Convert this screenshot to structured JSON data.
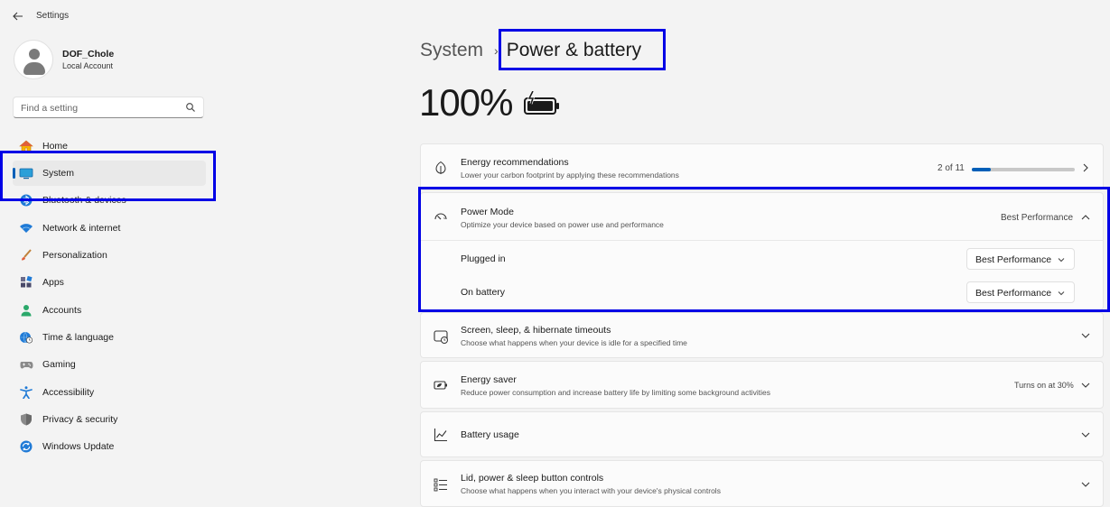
{
  "window": {
    "title": "Settings"
  },
  "profile": {
    "name": "DOF_Chole",
    "account": "Local Account"
  },
  "search": {
    "placeholder": "Find a setting"
  },
  "sidebar": {
    "items": [
      {
        "label": "Home",
        "icon": "home-icon"
      },
      {
        "label": "System",
        "icon": "system-icon",
        "selected": true
      },
      {
        "label": "Bluetooth & devices",
        "icon": "bluetooth-icon"
      },
      {
        "label": "Network & internet",
        "icon": "wifi-icon"
      },
      {
        "label": "Personalization",
        "icon": "brush-icon"
      },
      {
        "label": "Apps",
        "icon": "apps-icon"
      },
      {
        "label": "Accounts",
        "icon": "accounts-icon"
      },
      {
        "label": "Time & language",
        "icon": "globe-clock-icon"
      },
      {
        "label": "Gaming",
        "icon": "gamepad-icon"
      },
      {
        "label": "Accessibility",
        "icon": "accessibility-icon"
      },
      {
        "label": "Privacy & security",
        "icon": "shield-icon"
      },
      {
        "label": "Windows Update",
        "icon": "update-icon"
      }
    ]
  },
  "header": {
    "parent": "System",
    "separator": "›",
    "current": "Power & battery"
  },
  "battery": {
    "percent_text": "100%",
    "level": 1.0,
    "charging": true
  },
  "cards": {
    "energy": {
      "title": "Energy recommendations",
      "subtitle": "Lower your carbon footprint by applying these recommendations",
      "progress_text": "2 of 11",
      "progress_fraction": 0.1818
    },
    "power_mode": {
      "title": "Power Mode",
      "subtitle": "Optimize your device based on power use and performance",
      "value": "Best Performance",
      "plugged_in_label": "Plugged in",
      "plugged_in_value": "Best Performance",
      "on_battery_label": "On battery",
      "on_battery_value": "Best Performance"
    },
    "screen_sleep": {
      "title": "Screen, sleep, & hibernate timeouts",
      "subtitle": "Choose what happens when your device is idle for a specified time"
    },
    "energy_saver": {
      "title": "Energy saver",
      "subtitle": "Reduce power consumption and increase battery life by limiting some background activities",
      "status": "Turns on at 30%"
    },
    "battery_usage": {
      "title": "Battery usage"
    },
    "lid_power": {
      "title": "Lid, power & sleep button controls",
      "subtitle": "Choose what happens when you interact with your device's physical controls"
    }
  },
  "colors": {
    "accent": "#005fb8",
    "highlight_box": "#0000e6"
  }
}
